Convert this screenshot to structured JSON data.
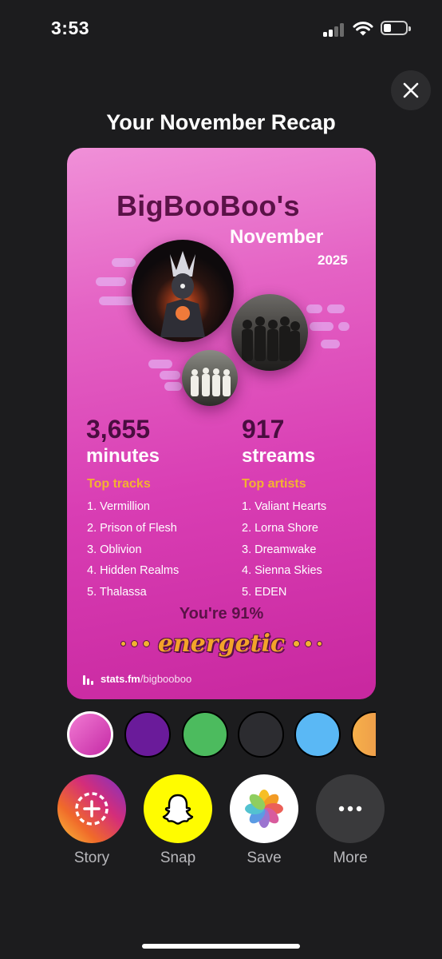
{
  "status_bar": {
    "time": "3:53"
  },
  "sheet": {
    "title": "Your November Recap",
    "close_icon": "close-icon"
  },
  "card": {
    "user_heading": "BigBooBoo's",
    "month": "November",
    "year": "2025",
    "minutes": {
      "value": "3,655",
      "unit": "minutes"
    },
    "streams": {
      "value": "917",
      "unit": "streams"
    },
    "top_tracks": {
      "heading": "Top tracks",
      "items": [
        "1. Vermillion",
        "2. Prison of Flesh",
        "3. Oblivion",
        "4. Hidden Realms",
        "5. Thalassa"
      ]
    },
    "top_artists": {
      "heading": "Top artists",
      "items": [
        "1. Valiant Hearts",
        "2. Lorna Shore",
        "3. Dreamwake",
        "4. Sienna Skies",
        "5. EDEN"
      ]
    },
    "mood_line": "You're 91%",
    "mood_word": "energetic",
    "footer": {
      "brand": "stats.fm",
      "path": "/bigbooboo"
    },
    "colors": {
      "accent": "#f3b230",
      "dark_text": "#5a1247"
    }
  },
  "color_swatches": [
    {
      "name": "pink",
      "color": "#e04cbf",
      "selected": true
    },
    {
      "name": "purple",
      "color": "#6a1b9a",
      "selected": false
    },
    {
      "name": "green",
      "color": "#4cbb5e",
      "selected": false
    },
    {
      "name": "dark",
      "color": "#2c2c30",
      "selected": false
    },
    {
      "name": "light-blue",
      "color": "#5ab8f5",
      "selected": false
    },
    {
      "name": "orange",
      "color": "#f0a050",
      "selected": false
    }
  ],
  "share_buttons": [
    {
      "label": "Story",
      "icon": "instagram-story-icon"
    },
    {
      "label": "Snap",
      "icon": "snapchat-ghost-icon"
    },
    {
      "label": "Save",
      "icon": "photos-icon"
    },
    {
      "label": "More",
      "icon": "more-icon"
    }
  ]
}
